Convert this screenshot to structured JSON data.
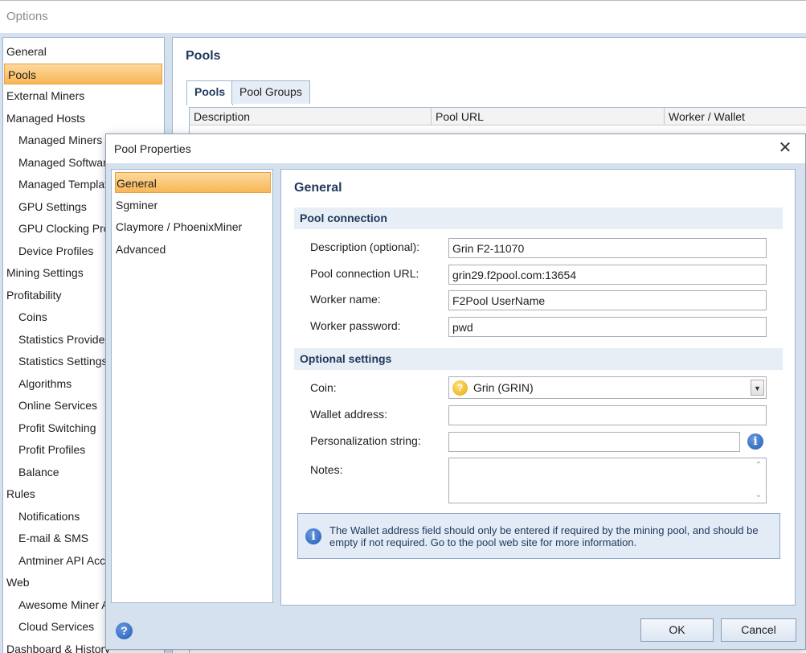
{
  "options": {
    "title": "Options",
    "nav": [
      {
        "label": "General",
        "indent": false,
        "selected": false
      },
      {
        "label": "Pools",
        "indent": false,
        "selected": true
      },
      {
        "label": "External Miners",
        "indent": false,
        "selected": false
      },
      {
        "label": "Managed Hosts",
        "indent": false,
        "selected": false
      },
      {
        "label": "Managed Miners",
        "indent": true,
        "selected": false
      },
      {
        "label": "Managed Software",
        "indent": true,
        "selected": false
      },
      {
        "label": "Managed Templates",
        "indent": true,
        "selected": false
      },
      {
        "label": "GPU Settings",
        "indent": true,
        "selected": false
      },
      {
        "label": "GPU Clocking Profiles",
        "indent": true,
        "selected": false
      },
      {
        "label": "Device Profiles",
        "indent": true,
        "selected": false
      },
      {
        "label": "Mining Settings",
        "indent": false,
        "selected": false
      },
      {
        "label": "Profitability",
        "indent": false,
        "selected": false
      },
      {
        "label": "Coins",
        "indent": true,
        "selected": false
      },
      {
        "label": "Statistics Providers",
        "indent": true,
        "selected": false
      },
      {
        "label": "Statistics Settings",
        "indent": true,
        "selected": false
      },
      {
        "label": "Algorithms",
        "indent": true,
        "selected": false
      },
      {
        "label": "Online Services",
        "indent": true,
        "selected": false
      },
      {
        "label": "Profit Switching",
        "indent": true,
        "selected": false
      },
      {
        "label": "Profit Profiles",
        "indent": true,
        "selected": false
      },
      {
        "label": "Balance",
        "indent": true,
        "selected": false
      },
      {
        "label": "Rules",
        "indent": false,
        "selected": false
      },
      {
        "label": "Notifications",
        "indent": true,
        "selected": false
      },
      {
        "label": "E-mail & SMS",
        "indent": true,
        "selected": false
      },
      {
        "label": "Antminer API Access",
        "indent": true,
        "selected": false
      },
      {
        "label": "Web",
        "indent": false,
        "selected": false
      },
      {
        "label": "Awesome Miner API",
        "indent": true,
        "selected": false
      },
      {
        "label": "Cloud Services",
        "indent": true,
        "selected": false
      },
      {
        "label": "Dashboard & History",
        "indent": false,
        "selected": false
      }
    ]
  },
  "pools_panel": {
    "title": "Pools",
    "tabs": [
      {
        "label": "Pools",
        "active": true
      },
      {
        "label": "Pool Groups",
        "active": false
      }
    ],
    "columns": [
      "Description",
      "Pool URL",
      "Worker / Wallet"
    ]
  },
  "dialog": {
    "title": "Pool Properties",
    "close_glyph": "✕",
    "nav": [
      {
        "label": "General",
        "selected": true
      },
      {
        "label": "Sgminer",
        "selected": false
      },
      {
        "label": "Claymore / PhoenixMiner",
        "selected": false
      },
      {
        "label": "Advanced",
        "selected": false
      }
    ],
    "section_title": "General",
    "pool_connection": {
      "header": "Pool connection",
      "description_label": "Description (optional):",
      "description_value": "Grin F2-11070",
      "url_label": "Pool connection URL:",
      "url_value": "grin29.f2pool.com:13654",
      "worker_label": "Worker name:",
      "worker_value": "F2Pool UserName",
      "password_label": "Worker password:",
      "password_value": "pwd"
    },
    "optional_settings": {
      "header": "Optional settings",
      "coin_label": "Coin:",
      "coin_value": "Grin (GRIN)",
      "coin_icon_glyph": "?",
      "wallet_label": "Wallet address:",
      "wallet_value": "",
      "personalization_label": "Personalization string:",
      "personalization_value": "",
      "notes_label": "Notes:",
      "notes_value": ""
    },
    "info_message": "The Wallet address field should only be entered if required by the mining pool, and should be empty if not required. Go to the pool web site for more information.",
    "help_glyph": "?",
    "info_glyph": "i",
    "ok_label": "OK",
    "cancel_label": "Cancel",
    "icons": {
      "coin": "grin-coin-icon",
      "info": "info-icon",
      "help": "help-icon",
      "close": "close-icon"
    }
  },
  "colors": {
    "accent_selected": "#f8b755",
    "header_text": "#1e395b",
    "frame_background": "#d5e1ef"
  }
}
